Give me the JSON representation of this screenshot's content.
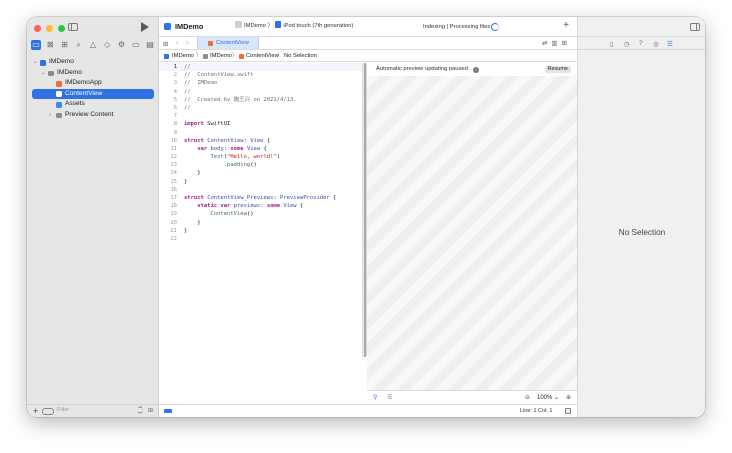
{
  "toolbar": {
    "project_title": "IMDemo",
    "scheme_target": "IMDemo",
    "device": "iPod touch (7th generation)",
    "status": "Indexing | Processing files",
    "add_label": "+",
    "run_icon": "play-icon",
    "sidebar_icon": "sidebar-left-icon"
  },
  "navigator": {
    "tree": [
      {
        "label": "IMDemo",
        "indent": 0,
        "chevron": "v",
        "icon": "project-icon",
        "selected": false
      },
      {
        "label": "IMDemo",
        "indent": 1,
        "chevron": "v",
        "icon": "folder-icon",
        "selected": false
      },
      {
        "label": "IMDemoApp",
        "indent": 2,
        "chevron": "",
        "icon": "swift-file-icon",
        "selected": false
      },
      {
        "label": "ContentView",
        "indent": 2,
        "chevron": "",
        "icon": "swift-file-icon",
        "selected": true
      },
      {
        "label": "Assets",
        "indent": 2,
        "chevron": "",
        "icon": "assets-icon",
        "selected": false
      },
      {
        "label": "Preview Content",
        "indent": 2,
        "chevron": ">",
        "icon": "folder-icon",
        "selected": false
      }
    ],
    "filter_placeholder": "Filter",
    "footer_plus": "+",
    "footer_right": "⌚ ⊞"
  },
  "tabs": {
    "active_tab": "ContentView"
  },
  "jumpbar": {
    "items": [
      "IMDemo",
      "IMDemo",
      "ContentView",
      "No Selection"
    ]
  },
  "code": {
    "lines": [
      {
        "n": "1",
        "tokens": [
          {
            "c": "comment",
            "t": "//"
          }
        ]
      },
      {
        "n": "2",
        "tokens": [
          {
            "c": "comment",
            "t": "//  ContentView.swift"
          }
        ]
      },
      {
        "n": "3",
        "tokens": [
          {
            "c": "comment",
            "t": "//  IMDemo"
          }
        ]
      },
      {
        "n": "4",
        "tokens": [
          {
            "c": "comment",
            "t": "//"
          }
        ]
      },
      {
        "n": "5",
        "tokens": [
          {
            "c": "comment",
            "t": "//  Created by 施王兴 on 2022/4/13."
          }
        ]
      },
      {
        "n": "6",
        "tokens": [
          {
            "c": "comment",
            "t": "//"
          }
        ]
      },
      {
        "n": "7",
        "tokens": []
      },
      {
        "n": "8",
        "tokens": [
          {
            "c": "kw",
            "t": "import"
          },
          {
            "c": "plain",
            "t": " SwiftUI"
          }
        ]
      },
      {
        "n": "9",
        "tokens": []
      },
      {
        "n": "10",
        "tokens": [
          {
            "c": "kw",
            "t": "struct"
          },
          {
            "c": "plain",
            "t": " "
          },
          {
            "c": "type",
            "t": "ContentView"
          },
          {
            "c": "plain",
            "t": ": "
          },
          {
            "c": "type",
            "t": "View"
          },
          {
            "c": "plain",
            "t": " {"
          }
        ]
      },
      {
        "n": "11",
        "tokens": [
          {
            "c": "plain",
            "t": "    "
          },
          {
            "c": "kw",
            "t": "var"
          },
          {
            "c": "plain",
            "t": " "
          },
          {
            "c": "type",
            "t": "body"
          },
          {
            "c": "plain",
            "t": ": "
          },
          {
            "c": "kw",
            "t": "some"
          },
          {
            "c": "plain",
            "t": " "
          },
          {
            "c": "type",
            "t": "View"
          },
          {
            "c": "plain",
            "t": " {"
          }
        ]
      },
      {
        "n": "12",
        "tokens": [
          {
            "c": "plain",
            "t": "        "
          },
          {
            "c": "fn",
            "t": "Text"
          },
          {
            "c": "plain",
            "t": "("
          },
          {
            "c": "str",
            "t": "\"Hello, world!\""
          },
          {
            "c": "plain",
            "t": ")"
          }
        ]
      },
      {
        "n": "13",
        "tokens": [
          {
            "c": "plain",
            "t": "            ."
          },
          {
            "c": "fn",
            "t": "padding"
          },
          {
            "c": "plain",
            "t": "()"
          }
        ]
      },
      {
        "n": "14",
        "tokens": [
          {
            "c": "plain",
            "t": "    }"
          }
        ]
      },
      {
        "n": "15",
        "tokens": [
          {
            "c": "plain",
            "t": "}"
          }
        ]
      },
      {
        "n": "16",
        "tokens": []
      },
      {
        "n": "17",
        "tokens": [
          {
            "c": "kw",
            "t": "struct"
          },
          {
            "c": "plain",
            "t": " "
          },
          {
            "c": "type",
            "t": "ContentView_Previews"
          },
          {
            "c": "plain",
            "t": ": "
          },
          {
            "c": "type",
            "t": "PreviewProvider"
          },
          {
            "c": "plain",
            "t": " {"
          }
        ]
      },
      {
        "n": "18",
        "tokens": [
          {
            "c": "plain",
            "t": "    "
          },
          {
            "c": "kw",
            "t": "static"
          },
          {
            "c": "plain",
            "t": " "
          },
          {
            "c": "kw",
            "t": "var"
          },
          {
            "c": "plain",
            "t": " "
          },
          {
            "c": "type",
            "t": "previews"
          },
          {
            "c": "plain",
            "t": ": "
          },
          {
            "c": "kw",
            "t": "some"
          },
          {
            "c": "plain",
            "t": " "
          },
          {
            "c": "type",
            "t": "View"
          },
          {
            "c": "plain",
            "t": " {"
          }
        ]
      },
      {
        "n": "19",
        "tokens": [
          {
            "c": "plain",
            "t": "        "
          },
          {
            "c": "fn",
            "t": "ContentView"
          },
          {
            "c": "plain",
            "t": "()"
          }
        ]
      },
      {
        "n": "20",
        "tokens": [
          {
            "c": "plain",
            "t": "    }"
          }
        ]
      },
      {
        "n": "21",
        "tokens": [
          {
            "c": "plain",
            "t": "}"
          }
        ]
      },
      {
        "n": "22",
        "tokens": []
      }
    ],
    "current_line": "1"
  },
  "canvas": {
    "message": "Automatic preview updating paused",
    "resume_label": "Resume",
    "zoom": "100% ⌄",
    "zoom_out": "⊖",
    "zoom_in": "⊕"
  },
  "status_bar": {
    "line_col": "Line: 1  Col: 1"
  },
  "inspector": {
    "no_selection": "No Selection"
  },
  "colors": {
    "accent": "#2f72e6",
    "swift": "#f26b3a",
    "keyword": "#a21a8c",
    "type": "#3b4db0",
    "string": "#c41a16"
  }
}
